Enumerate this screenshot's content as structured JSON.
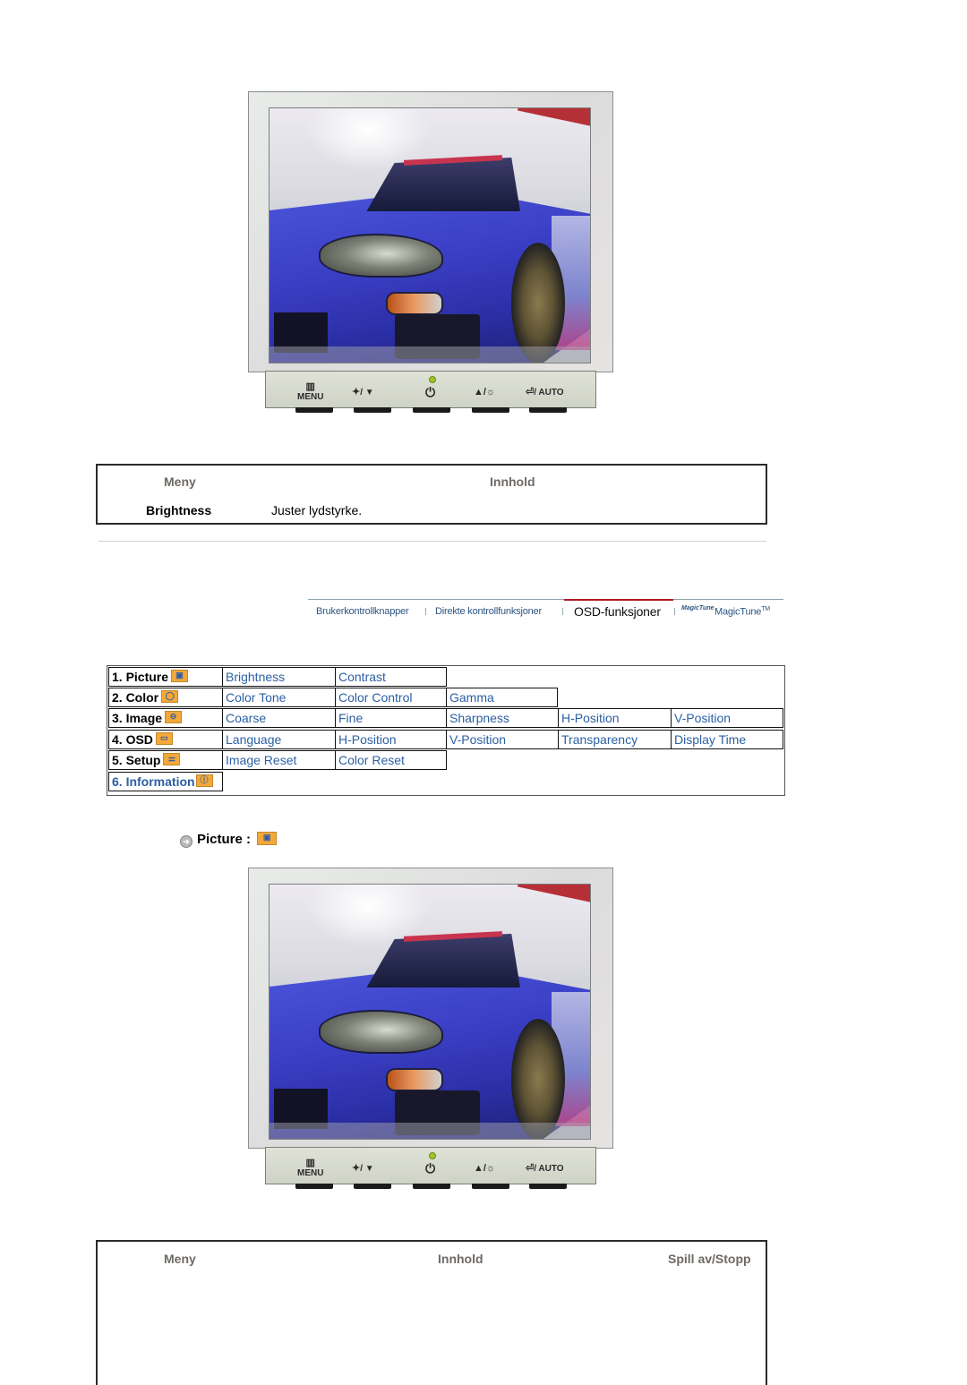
{
  "monitor": {
    "buttons": [
      {
        "icon": "menu-icon",
        "glyph": "▥",
        "label": "MENU"
      },
      {
        "icon": "magicbright-down-icon",
        "glyph": "✦",
        "label": "/ ▼"
      },
      {
        "icon": "power-icon",
        "glyph": "⏻",
        "label": ""
      },
      {
        "icon": "up-brightness-icon",
        "glyph": "▲/☼",
        "label": ""
      },
      {
        "icon": "enter-auto-icon",
        "glyph": "⏎",
        "label": "/ AUTO"
      }
    ],
    "led_color": "#9ec521"
  },
  "table1": {
    "header_menu": "Meny",
    "header_content": "Innhold",
    "rows": [
      {
        "name": "Brightness",
        "desc": "Juster lydstyrke."
      }
    ]
  },
  "nav": {
    "tabs": [
      {
        "label": "Brukerkontrollknapper",
        "active": false
      },
      {
        "label": "Direkte kontrollfunksjoner",
        "active": false
      },
      {
        "label": "OSD-funksjoner",
        "active": true
      },
      {
        "label": "MagicTune",
        "active": false
      }
    ],
    "magictune_logo": "MagicTune",
    "tm": "TM",
    "active_color": "#b01a24"
  },
  "osd": {
    "menus": [
      {
        "label": "1. Picture",
        "icon": "picture-icon",
        "glyph": "▣",
        "items": [
          "Brightness",
          "Contrast"
        ]
      },
      {
        "label": "2. Color",
        "icon": "color-icon",
        "glyph": "◯",
        "items": [
          "Color Tone",
          "Color Control",
          "Gamma"
        ]
      },
      {
        "label": "3. Image",
        "icon": "image-icon",
        "glyph": "⊖",
        "items": [
          "Coarse",
          "Fine",
          "Sharpness",
          "H-Position",
          "V-Position"
        ]
      },
      {
        "label": "4. OSD",
        "icon": "osd-icon",
        "glyph": "▭",
        "items": [
          "Language",
          "H-Position",
          "V-Position",
          "Transparency",
          "Display Time"
        ]
      },
      {
        "label": "5. Setup",
        "icon": "setup-icon",
        "glyph": "⚌",
        "items": [
          "Image Reset",
          "Color Reset"
        ]
      },
      {
        "label": "6. Information",
        "icon": "information-icon",
        "glyph": "ⓘ",
        "items": []
      }
    ],
    "link_color": "#2c5fa3",
    "icon_color": "#f3a83a"
  },
  "section": {
    "title": "Picture :"
  },
  "table2": {
    "header_menu": "Meny",
    "header_content": "Innhold",
    "header_play": "Spill av/Stopp"
  }
}
